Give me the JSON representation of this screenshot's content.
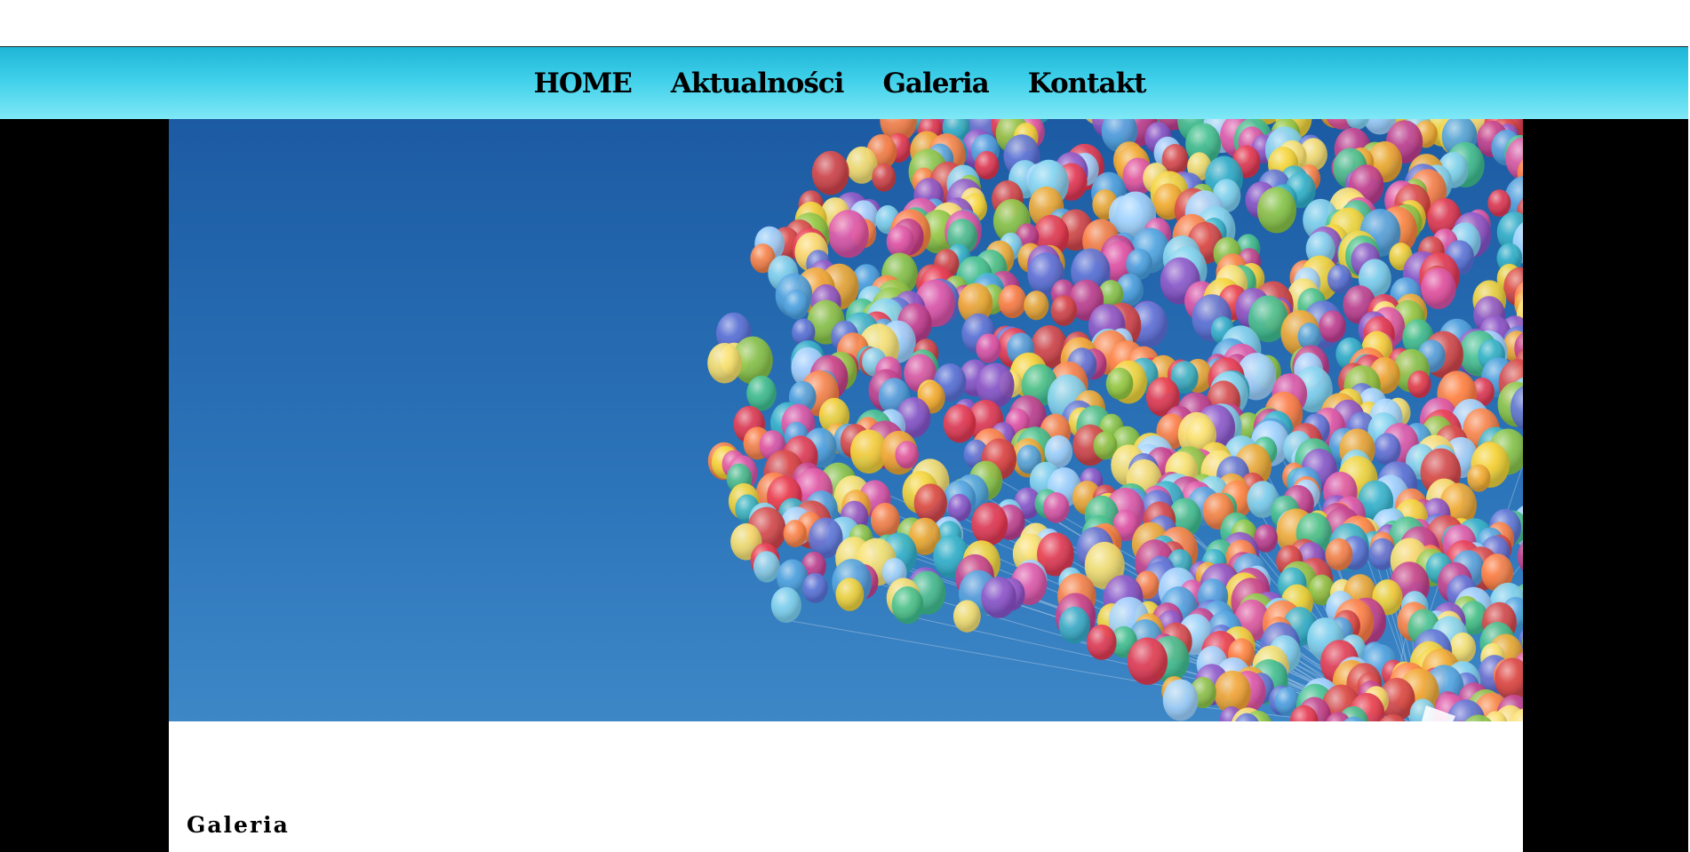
{
  "nav": {
    "items": [
      {
        "label": "HOME"
      },
      {
        "label": "Aktualności"
      },
      {
        "label": "Galeria"
      },
      {
        "label": "Kontakt"
      }
    ]
  },
  "hero": {
    "image": "balloons-photo",
    "sky_color": "#2d74b8"
  },
  "content": {
    "section_title": "Galeria"
  },
  "colors": {
    "nav_gradient_top": "#1fb5d6",
    "nav_gradient_bottom": "#7fe8f6",
    "page_background": "#000000",
    "content_background": "#ffffff"
  }
}
